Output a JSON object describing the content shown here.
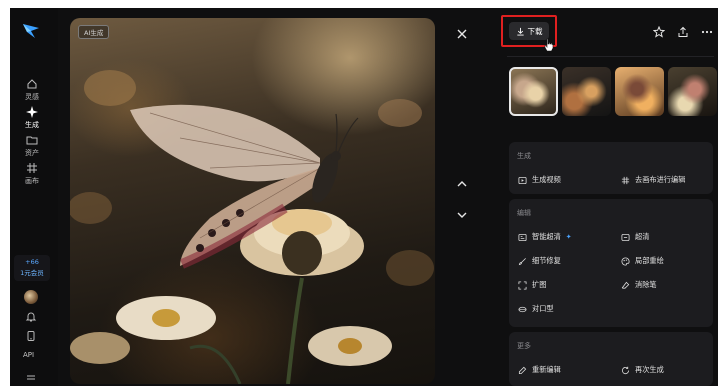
{
  "sidebar": {
    "items": [
      {
        "label": "灵感",
        "icon": "home-icon"
      },
      {
        "label": "生成",
        "icon": "sparkle-icon",
        "active": true
      },
      {
        "label": "资产",
        "icon": "folder-icon"
      },
      {
        "label": "画布",
        "icon": "canvas-grid-icon"
      }
    ],
    "points": "+66",
    "membership": "1元会员",
    "api_label": "API"
  },
  "viewer": {
    "ai_tag": "AI生成"
  },
  "panel": {
    "download_label": "下载",
    "sections": [
      {
        "title": "生成",
        "actions": [
          {
            "label": "生成视频",
            "icon": "video-play-icon"
          },
          {
            "label": "去画布进行编辑",
            "icon": "canvas-grid-icon"
          }
        ]
      },
      {
        "title": "编辑",
        "actions": [
          {
            "label": "智能超清",
            "icon": "hd-icon"
          },
          {
            "label": "超清",
            "icon": "hd-box-icon"
          },
          {
            "label": "细节修复",
            "icon": "brush-icon"
          },
          {
            "label": "局部重绘",
            "icon": "palette-icon"
          },
          {
            "label": "扩图",
            "icon": "expand-icon"
          },
          {
            "label": "消除笔",
            "icon": "eraser-icon"
          },
          {
            "label": "对口型",
            "icon": "lip-sync-icon"
          }
        ]
      },
      {
        "title": "更多",
        "actions": [
          {
            "label": "重新编辑",
            "icon": "edit-icon"
          },
          {
            "label": "再次生成",
            "icon": "refresh-icon"
          }
        ]
      }
    ]
  },
  "colors": {
    "accent_blue": "#4aa3ff",
    "highlight_red": "#e02020",
    "background": "#0f0f10",
    "card": "#1c1c1f"
  }
}
